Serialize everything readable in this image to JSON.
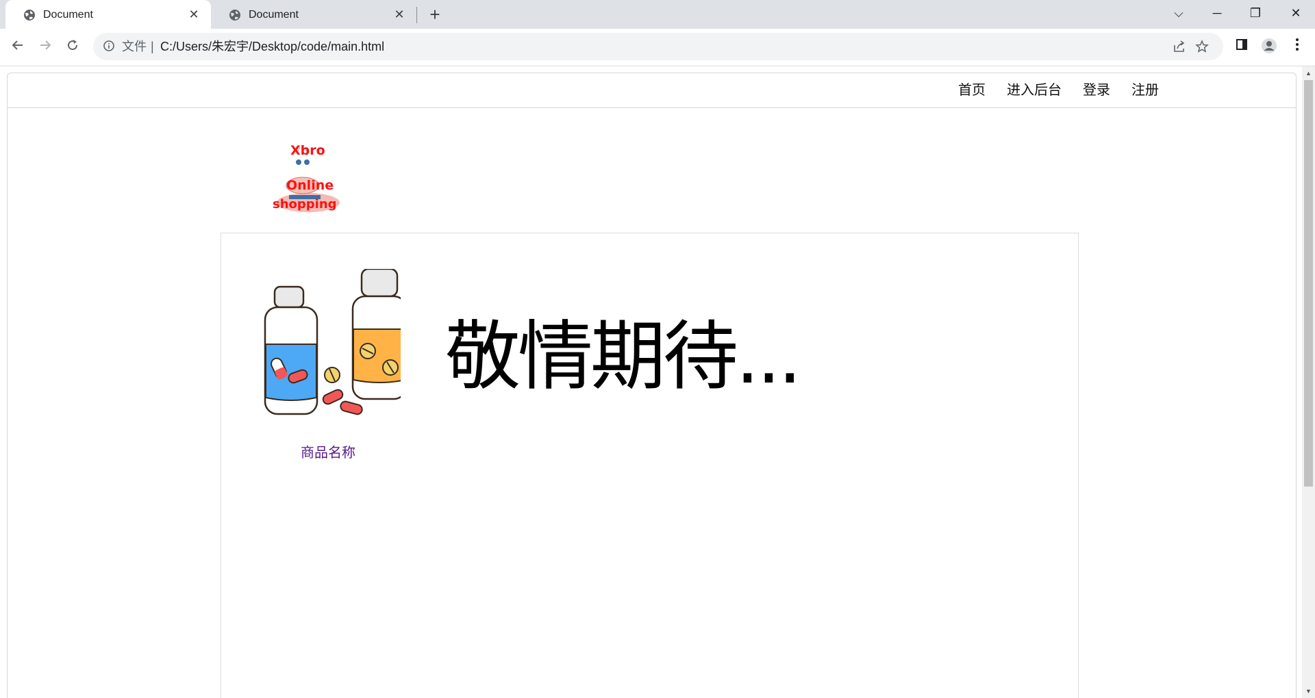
{
  "browser": {
    "tabs": [
      {
        "title": "Document",
        "active": true
      },
      {
        "title": "Document",
        "active": false
      }
    ],
    "new_tab": "+",
    "controls": {
      "tab_search": "⌵",
      "minimize": "─",
      "restore": "❐",
      "close": "✕"
    },
    "address": {
      "file_label": "文件",
      "separator": "|",
      "url": "C:/Users/朱宏宇/Desktop/code/main.html"
    }
  },
  "nav": {
    "items": [
      "首页",
      "进入后台",
      "登录",
      "注册"
    ]
  },
  "logo": {
    "lines": [
      "Xbro",
      "Online",
      "shopping"
    ]
  },
  "main": {
    "coming_soon": "敬情期待...",
    "product_name": "商品名称"
  },
  "colors": {
    "tabstrip_bg": "#dee1e6",
    "link_visited": "#551a8b",
    "logo_red": "#ff1010",
    "bottle_blue": "#4da9f5",
    "bottle_orange": "#ffb347"
  }
}
